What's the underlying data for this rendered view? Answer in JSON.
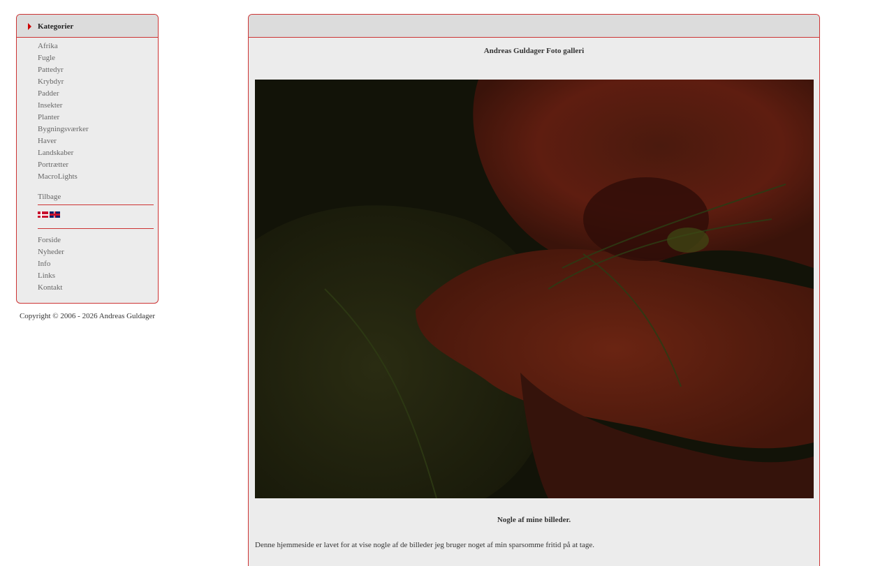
{
  "sidebar": {
    "title": "Kategorier",
    "categories": [
      {
        "label": "Afrika"
      },
      {
        "label": "Fugle"
      },
      {
        "label": "Pattedyr"
      },
      {
        "label": "Krybdyr"
      },
      {
        "label": "Padder"
      },
      {
        "label": "Insekter"
      },
      {
        "label": "Planter"
      },
      {
        "label": "Bygningsværker"
      },
      {
        "label": "Haver"
      },
      {
        "label": "Landskaber"
      },
      {
        "label": "Portrætter"
      },
      {
        "label": "MacroLights"
      }
    ],
    "back_label": "Tilbage",
    "languages": [
      {
        "name": "Dansk",
        "icon": "danish-flag-icon"
      },
      {
        "name": "English",
        "icon": "uk-flag-icon"
      }
    ],
    "pages": [
      {
        "label": "Forside"
      },
      {
        "label": "Nyheder"
      },
      {
        "label": "Info"
      },
      {
        "label": "Links"
      },
      {
        "label": "Kontakt"
      }
    ]
  },
  "footer": {
    "copyright": "Copyright © 2006 - 2026 Andreas Guldager"
  },
  "main": {
    "gallery_title": "Andreas Guldager Foto galleri",
    "photo_caption": "Nogle af mine billeder.",
    "intro_text": "Denne hjemmeside er lavet for at vise nogle af de billeder jeg bruger noget af min sparsomme fritid på at tage."
  },
  "colors": {
    "accent": "#cc3333",
    "panel_bg": "#ececec",
    "header_bg": "#dcdcdc",
    "link": "#666666"
  }
}
